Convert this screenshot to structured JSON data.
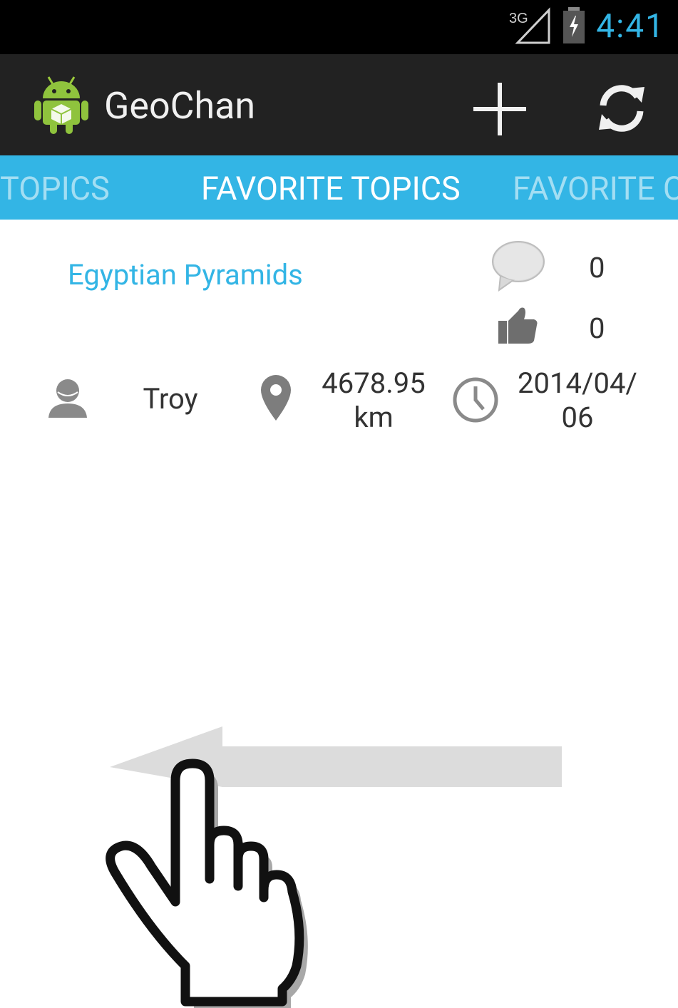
{
  "status_bar": {
    "time": "4:41",
    "network": "3G",
    "colors": {
      "accent": "#33b5e5",
      "background": "#000000"
    }
  },
  "action_bar": {
    "title": "GeoChan",
    "icons": [
      "android-logo-icon",
      "add-icon",
      "refresh-icon"
    ]
  },
  "tabs": [
    {
      "label": "TOPICS",
      "active": false
    },
    {
      "label": "FAVORITE TOPICS",
      "active": true
    },
    {
      "label": "FAVORITE C",
      "active": false
    }
  ],
  "topic": {
    "title": "Egyptian Pyramids",
    "comments": "0",
    "likes": "0",
    "author": "Troy",
    "distance_line1": "4678.95",
    "distance_line2": "km",
    "date_line1": "2014/04/",
    "date_line2": "06"
  },
  "gesture": {
    "type": "swipe-left",
    "icons": [
      "swipe-left-arrow-icon",
      "hand-pointer-icon"
    ]
  }
}
